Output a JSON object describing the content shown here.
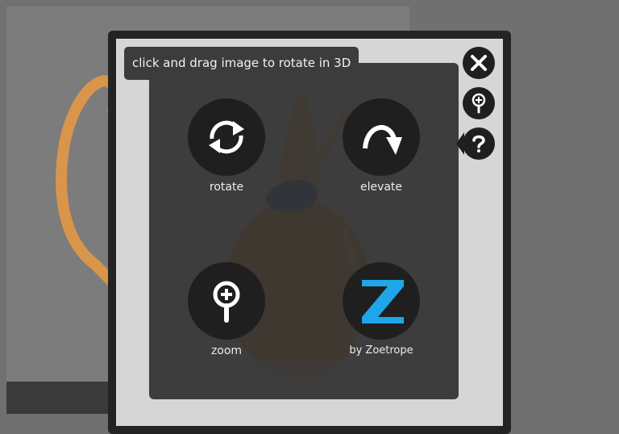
{
  "tooltip": {
    "text": "click and drag image to rotate in 3D"
  },
  "help": {
    "items": [
      {
        "label": "rotate",
        "icon": "rotate-icon"
      },
      {
        "label": "elevate",
        "icon": "elevate-icon"
      },
      {
        "label": "zoom",
        "icon": "zoom-icon"
      },
      {
        "label": "by Zoetrope",
        "icon": "zoetrope-logo"
      }
    ]
  },
  "controls": {
    "close": "close-icon",
    "zoom": "zoom-icon",
    "help": "help-icon"
  },
  "colors": {
    "brand_blue": "#1ea6e8",
    "button_bg": "#1f1f1f",
    "overlay_bg": "#303030",
    "plush_orange": "#e89a3c",
    "hat_blue": "#3d6aa6"
  }
}
